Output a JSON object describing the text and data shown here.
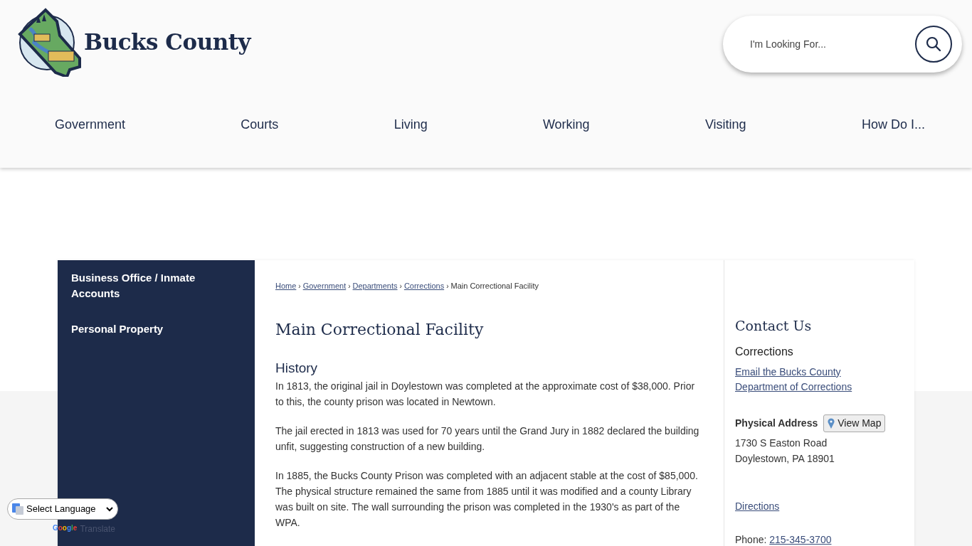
{
  "header": {
    "site_name": "Bucks County",
    "search": {
      "placeholder": "I'm Looking For..."
    }
  },
  "nav": [
    {
      "label": "Government"
    },
    {
      "label": "Courts"
    },
    {
      "label": "Living"
    },
    {
      "label": "Working"
    },
    {
      "label": "Visiting"
    },
    {
      "label": "How Do I..."
    }
  ],
  "sidebar": {
    "items": [
      {
        "label": "Business Office / Inmate Accounts"
      },
      {
        "label": "Personal Property"
      }
    ]
  },
  "breadcrumb": [
    {
      "label": "Home",
      "link": true
    },
    {
      "label": "Government",
      "link": true
    },
    {
      "label": "Departments",
      "link": true
    },
    {
      "label": "Corrections",
      "link": true
    },
    {
      "label": "Main Correctional Facility",
      "link": false
    }
  ],
  "breadcrumb_separator": "›",
  "page_title": "Main Correctional Facility",
  "section_heading": "History",
  "paragraphs": [
    "In 1813, the original jail in Doylestown was completed at the approximate cost of $38,000. Prior to this, the county prison was located in Newtown.",
    "The jail erected in 1813 was used for 70 years until the Grand Jury in 1882 declared the building unfit, suggesting construction of a new building.",
    "In 1885, the Bucks County Prison was completed with an adjacent stable at the cost of $85,000. The physical structure remained the same from 1885 until it was modified and a county Library was built on site. The wall surrounding the prison was completed in the 1930's as part of the WPA."
  ],
  "contact": {
    "title": "Contact Us",
    "department": "Corrections",
    "email_link": "Email the Bucks County Department of Corrections",
    "address_label": "Physical Address",
    "map_button": "View Map",
    "address_lines": [
      "1730 S Easton Road",
      "Doylestown, PA 18901"
    ],
    "directions_link": "Directions",
    "phone_label": "Phone:",
    "phone": "215-345-3700"
  },
  "translate": {
    "select": "Select Language",
    "brand": "Google",
    "label": "Translate"
  }
}
